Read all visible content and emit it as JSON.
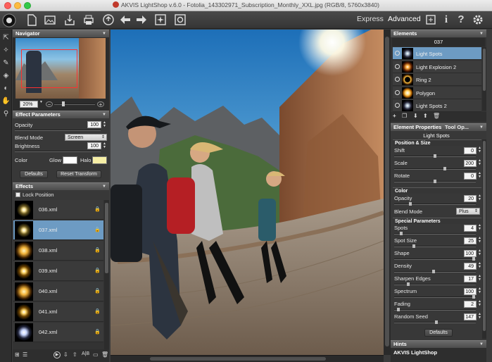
{
  "window": {
    "title": "AKVIS LightShop v.6.0 - Fotolia_143302971_Subscription_Monthly_XXL.jpg (RGB/8, 5760x3840)"
  },
  "toolbar": {
    "mode_express": "Express",
    "mode_advanced": "Advanced"
  },
  "navigator": {
    "title": "Navigator",
    "zoom": "20%"
  },
  "effect_params": {
    "title": "Effect Parameters",
    "opacity_label": "Opacity",
    "opacity_value": "100",
    "blend_label": "Blend Mode",
    "blend_value": "Screen",
    "brightness_label": "Brightness",
    "brightness_value": "100",
    "color_label": "Color",
    "glow_label": "Glow",
    "halo_label": "Halo",
    "defaults_button": "Defaults",
    "reset_button": "Reset Transform"
  },
  "effects": {
    "title": "Effects",
    "lock_label": "Lock Position",
    "items": [
      {
        "label": "036.xml"
      },
      {
        "label": "037.xml"
      },
      {
        "label": "038.xml"
      },
      {
        "label": "039.xml"
      },
      {
        "label": "040.xml"
      },
      {
        "label": "041.xml"
      },
      {
        "label": "042.xml"
      }
    ],
    "selected_index": 1
  },
  "elements": {
    "title": "Elements",
    "current": "037",
    "items": [
      {
        "label": "Light Spots"
      },
      {
        "label": "Light Explosion 2"
      },
      {
        "label": "Ring 2"
      },
      {
        "label": "Polygon"
      },
      {
        "label": "Light Spots 2"
      }
    ],
    "selected_index": 0
  },
  "element_properties": {
    "tab1": "Element Properties",
    "tab2": "Tool Op...",
    "heading": "Light Spots",
    "position_section": "Position & Size",
    "shift_label": "Shift",
    "shift_value": "0",
    "scale_label": "Scale",
    "scale_value": "200",
    "rotate_label": "Rotate",
    "rotate_value": "0",
    "color_section": "Color",
    "opacity_label": "Opacity",
    "opacity_value": "20",
    "blend_label": "Blend Mode",
    "blend_value": "Plus",
    "special_section": "Special Parameters",
    "spots_label": "Spots",
    "spots_value": "4",
    "spotsize_label": "Spot Size",
    "spotsize_value": "25",
    "shape_label": "Shape",
    "shape_value": "100",
    "density_label": "Density",
    "density_value": "49",
    "sharpen_label": "Sharpen Edges",
    "sharpen_value": "17",
    "spectrum_label": "Spectrum",
    "spectrum_value": "100",
    "fading_label": "Fading",
    "fading_value": "2",
    "seed_label": "Random Seed",
    "seed_value": "147",
    "defaults_button": "Defaults"
  },
  "hints": {
    "title": "Hints",
    "text": "AKVIS LightShop"
  },
  "colors": {
    "glow": "#ffffff",
    "halo": "#f7efa6",
    "selection": "#6d9bc3"
  }
}
